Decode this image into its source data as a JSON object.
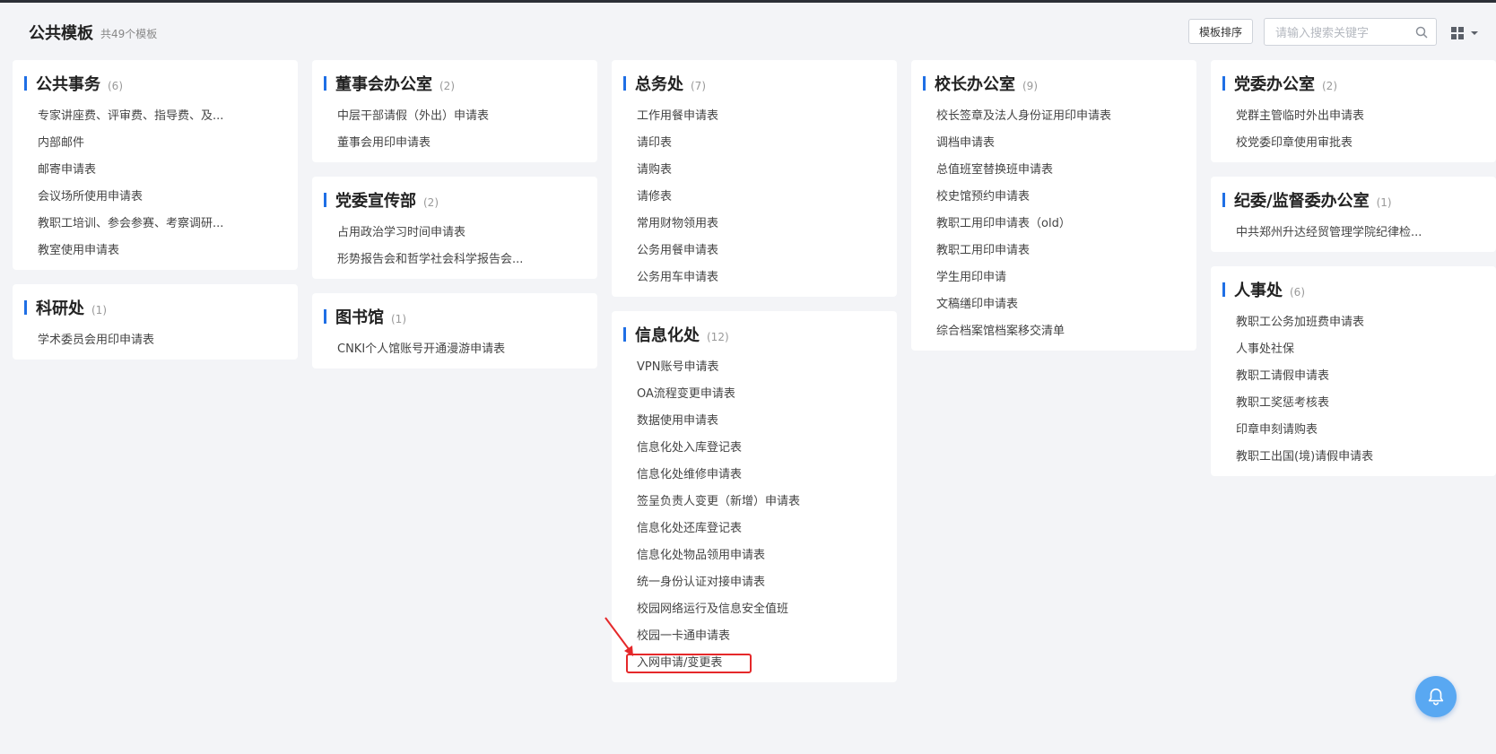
{
  "header": {
    "title": "公共模板",
    "count": "共49个模板",
    "sort_button": "模板排序",
    "search_placeholder": "请输入搜索关键字"
  },
  "colors": {
    "accent": "#1f6fe5",
    "highlight": "#e5282a",
    "bell": "#59a8f2"
  },
  "cards": {
    "public_affairs": {
      "title": "公共事务",
      "count": "(6)",
      "items": [
        "专家讲座费、评审费、指导费、及...",
        "内部邮件",
        "邮寄申请表",
        "会议场所使用申请表",
        "教职工培训、参会参赛、考察调研...",
        "教室使用申请表"
      ]
    },
    "research": {
      "title": "科研处",
      "count": "(1)",
      "items": [
        "学术委员会用印申请表"
      ]
    },
    "board_office": {
      "title": "董事会办公室",
      "count": "(2)",
      "items": [
        "中层干部请假（外出）申请表",
        "董事会用印申请表"
      ]
    },
    "party_propaganda": {
      "title": "党委宣传部",
      "count": "(2)",
      "items": [
        "占用政治学习时间申请表",
        "形势报告会和哲学社会科学报告会..."
      ]
    },
    "library": {
      "title": "图书馆",
      "count": "(1)",
      "items": [
        "CNKI个人馆账号开通漫游申请表"
      ]
    },
    "general_affairs": {
      "title": "总务处",
      "count": "(7)",
      "items": [
        "工作用餐申请表",
        "请印表",
        "请购表",
        "请修表",
        "常用财物领用表",
        "公务用餐申请表",
        "公务用车申请表"
      ]
    },
    "info_office": {
      "title": "信息化处",
      "count": "(12)",
      "items": [
        "VPN账号申请表",
        "OA流程变更申请表",
        "数据使用申请表",
        "信息化处入库登记表",
        "信息化处维修申请表",
        "签呈负责人变更（新增）申请表",
        "信息化处还库登记表",
        "信息化处物品领用申请表",
        "统一身份认证对接申请表",
        "校园网络运行及信息安全值班",
        "校园一卡通申请表",
        "入网申请/变更表"
      ]
    },
    "president_office": {
      "title": "校长办公室",
      "count": "(9)",
      "items": [
        "校长签章及法人身份证用印申请表",
        "调档申请表",
        "总值班室替换班申请表",
        "校史馆预约申请表",
        "教职工用印申请表（old）",
        "教职工用印申请表",
        "学生用印申请",
        "文稿缮印申请表",
        "综合档案馆档案移交清单"
      ]
    },
    "party_office": {
      "title": "党委办公室",
      "count": "(2)",
      "items": [
        "党群主管临时外出申请表",
        "校党委印章使用审批表"
      ]
    },
    "discipline_office": {
      "title": "纪委/监督委办公室",
      "count": "(1)",
      "items": [
        "中共郑州升达经贸管理学院纪律检..."
      ]
    },
    "hr": {
      "title": "人事处",
      "count": "(6)",
      "items": [
        "教职工公务加班费申请表",
        "人事处社保",
        "教职工请假申请表",
        "教职工奖惩考核表",
        "印章申刻请购表",
        "教职工出国(境)请假申请表"
      ]
    }
  }
}
